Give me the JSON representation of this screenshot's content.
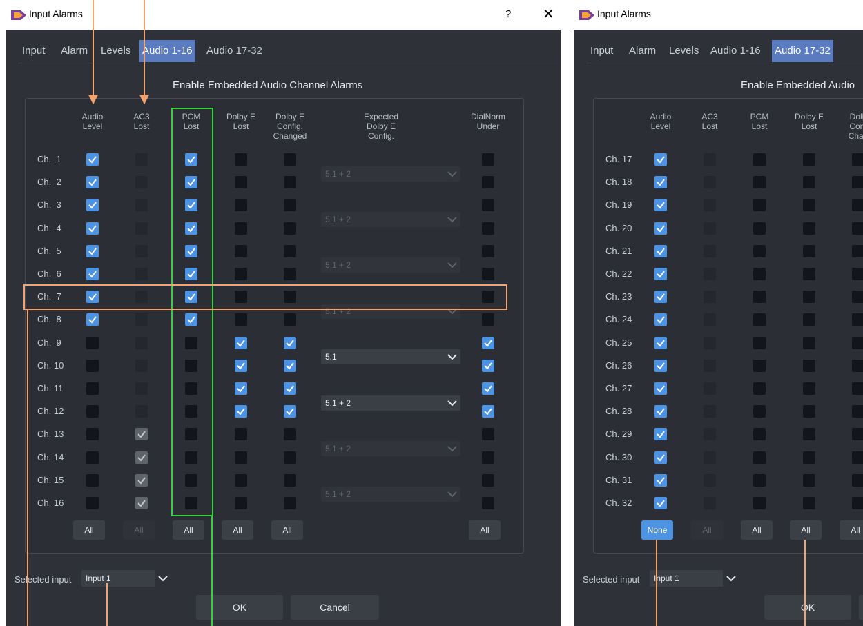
{
  "colors": {
    "accent": "#4c93e3",
    "tab_active": "#5b7bc0",
    "callout_orange": "#f4a36c",
    "callout_green": "#36d13f"
  },
  "left": {
    "title": "Input Alarms",
    "help": "?",
    "close": "✕",
    "tabs": [
      {
        "label": "Input"
      },
      {
        "label": "Alarm"
      },
      {
        "label": "Levels"
      },
      {
        "label": "Audio 1-16"
      },
      {
        "label": "Audio 17-32"
      }
    ],
    "active_tab": 3,
    "heading": "Enable Embedded Audio Channel Alarms",
    "headers": {
      "audio_level": "Audio\nLevel",
      "ac3_lost": "AC3\nLost",
      "pcm_lost": "PCM\nLost",
      "dolby_e_lost": "Dolby E\nLost",
      "dolby_e_config_changed": "Dolby E\nConfig.\nChanged",
      "expected_dolby_e_config": "Expected\nDolby E\nConfig.",
      "dialnorm_under": "DialNorm\nUnder"
    },
    "channels": [
      "Ch.  1",
      "Ch.  2",
      "Ch.  3",
      "Ch.  4",
      "Ch.  5",
      "Ch.  6",
      "Ch.  7",
      "Ch.  8",
      "Ch.  9",
      "Ch. 10",
      "Ch. 11",
      "Ch. 12",
      "Ch. 13",
      "Ch. 14",
      "Ch. 15",
      "Ch. 16"
    ],
    "checks": {
      "audio_level": [
        "on",
        "on",
        "on",
        "on",
        "on",
        "on",
        "on",
        "on",
        "off",
        "off",
        "off",
        "off",
        "off",
        "off",
        "off",
        "off"
      ],
      "ac3_lost": [
        "dis",
        "dis",
        "dis",
        "dis",
        "dis",
        "dis",
        "dis",
        "dis",
        "dis",
        "dis",
        "dis",
        "dis",
        "don",
        "don",
        "don",
        "don"
      ],
      "pcm_lost": [
        "on",
        "on",
        "on",
        "on",
        "on",
        "on",
        "on",
        "on",
        "off",
        "off",
        "off",
        "off",
        "off",
        "off",
        "off",
        "off"
      ],
      "dolby_e_lost": [
        "off",
        "off",
        "off",
        "off",
        "off",
        "off",
        "off",
        "off",
        "on",
        "on",
        "on",
        "on",
        "off",
        "off",
        "off",
        "off"
      ],
      "dolby_e_config_changed": [
        "off",
        "off",
        "off",
        "off",
        "off",
        "off",
        "off",
        "off",
        "on",
        "on",
        "on",
        "on",
        "off",
        "off",
        "off",
        "off"
      ],
      "dialnorm_under": [
        "off",
        "off",
        "off",
        "off",
        "off",
        "off",
        "off",
        "off",
        "on",
        "on",
        "on",
        "on",
        "off",
        "off",
        "off",
        "off"
      ]
    },
    "configs": [
      {
        "value": "5.1 + 2",
        "state": "dis"
      },
      {
        "value": "5.1 + 2",
        "state": "dis"
      },
      {
        "value": "5.1 + 2",
        "state": "dis"
      },
      {
        "value": "5.1 + 2",
        "state": "dis"
      },
      {
        "value": "5.1",
        "state": "on"
      },
      {
        "value": "5.1 + 2",
        "state": "on"
      },
      {
        "value": "5.1 + 2",
        "state": "dis"
      },
      {
        "value": "5.1 + 2",
        "state": "dis"
      }
    ],
    "buttons": [
      {
        "label": "All",
        "state": "on"
      },
      {
        "label": "All",
        "state": "dis"
      },
      {
        "label": "All",
        "state": "on"
      },
      {
        "label": "All",
        "state": "on"
      },
      {
        "label": "All",
        "state": "on"
      },
      {
        "label": "All",
        "state": "on"
      }
    ],
    "selected_input_label": "Selected input",
    "selected_input_value": "Input 1",
    "ok": "OK",
    "cancel": "Cancel"
  },
  "right": {
    "title": "Input Alarms",
    "tabs": [
      {
        "label": "Input"
      },
      {
        "label": "Alarm"
      },
      {
        "label": "Levels"
      },
      {
        "label": "Audio 1-16"
      },
      {
        "label": "Audio 17-32"
      }
    ],
    "active_tab": 4,
    "heading": "Enable Embedded Audio",
    "headers": {
      "audio_level": "Audio\nLevel",
      "ac3_lost": "AC3\nLost",
      "pcm_lost": "PCM\nLost",
      "dolby_e_lost": "Dolby E\nLost",
      "dolby_e_config_changed": "Dolb\nConf\nChan"
    },
    "channels": [
      "Ch. 17",
      "Ch. 18",
      "Ch. 19",
      "Ch. 20",
      "Ch. 21",
      "Ch. 22",
      "Ch. 23",
      "Ch. 24",
      "Ch. 25",
      "Ch. 26",
      "Ch. 27",
      "Ch. 28",
      "Ch. 29",
      "Ch. 30",
      "Ch. 31",
      "Ch. 32"
    ],
    "checks": {
      "audio_level": [
        "on",
        "on",
        "on",
        "on",
        "on",
        "on",
        "on",
        "on",
        "on",
        "on",
        "on",
        "on",
        "on",
        "on",
        "on",
        "on"
      ],
      "ac3_lost": [
        "dis",
        "dis",
        "dis",
        "dis",
        "dis",
        "dis",
        "dis",
        "dis",
        "dis",
        "dis",
        "dis",
        "dis",
        "dis",
        "dis",
        "dis",
        "dis"
      ],
      "pcm_lost": [
        "off",
        "off",
        "off",
        "off",
        "off",
        "off",
        "off",
        "off",
        "off",
        "off",
        "off",
        "off",
        "off",
        "off",
        "off",
        "off"
      ],
      "dolby_e_lost": [
        "off",
        "off",
        "off",
        "off",
        "off",
        "off",
        "off",
        "off",
        "off",
        "off",
        "off",
        "off",
        "off",
        "off",
        "off",
        "off"
      ],
      "dolby_e_config_changed": [
        "off",
        "off",
        "off",
        "off",
        "off",
        "off",
        "off",
        "off",
        "off",
        "off",
        "off",
        "off",
        "off",
        "off",
        "off",
        "off"
      ]
    },
    "buttons": [
      {
        "label": "None",
        "state": "blue"
      },
      {
        "label": "All",
        "state": "dis"
      },
      {
        "label": "All",
        "state": "on"
      },
      {
        "label": "All",
        "state": "on"
      },
      {
        "label": "All",
        "state": "on"
      }
    ],
    "selected_input_label": "Selected input",
    "selected_input_value": "Input 1",
    "ok": "OK"
  }
}
